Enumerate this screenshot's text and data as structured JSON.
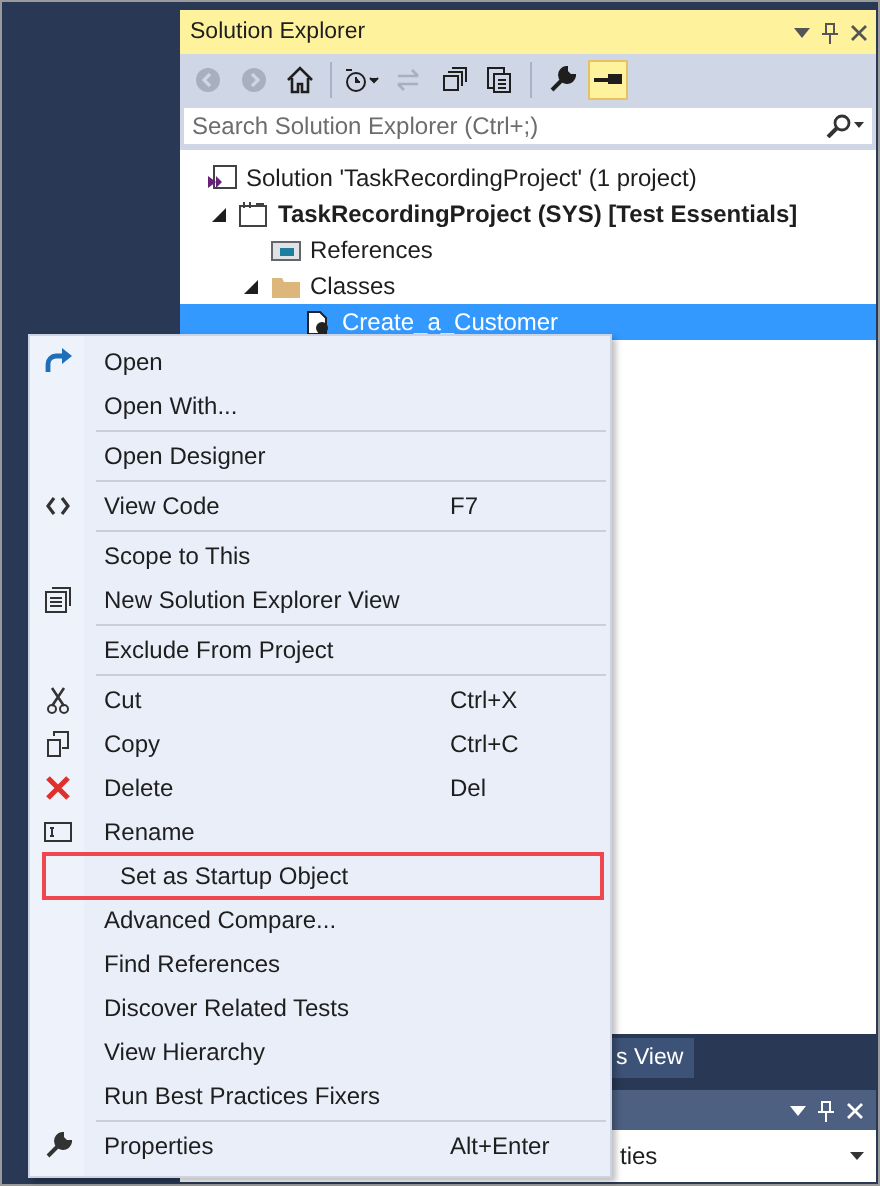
{
  "solution_explorer": {
    "title": "Solution Explorer",
    "toolbar": [
      {
        "kind": "back",
        "disabled": true
      },
      {
        "kind": "forward",
        "disabled": true
      },
      {
        "kind": "home",
        "disabled": false
      },
      {
        "kind": "history",
        "disabled": false
      },
      {
        "kind": "sync",
        "disabled": true
      },
      {
        "kind": "collapse",
        "disabled": false
      },
      {
        "kind": "copy",
        "disabled": false
      },
      {
        "kind": "properties",
        "disabled": false
      },
      {
        "kind": "preview",
        "disabled": false,
        "on": true
      }
    ],
    "search": {
      "placeholder": "Search Solution Explorer (Ctrl+;)"
    },
    "tree": [
      {
        "kind": "solution",
        "label": "Solution 'TaskRecordingProject' (1 project)",
        "selected": false,
        "children": [
          {
            "kind": "project",
            "label": "TaskRecordingProject (SYS) [Test Essentials]",
            "selected": false,
            "expanded": true,
            "children": [
              {
                "kind": "references",
                "label": "References",
                "selected": false
              },
              {
                "kind": "folder",
                "label": "Classes",
                "selected": false,
                "expanded": true,
                "children": [
                  {
                    "kind": "class",
                    "label": "Create_a_Customer",
                    "selected": true
                  }
                ]
              }
            ]
          }
        ]
      }
    ]
  },
  "tab_strip": {
    "tabs": [
      {
        "label": "s View",
        "selected": true
      }
    ]
  },
  "properties_panel": {
    "value": "ties"
  },
  "context_menu": {
    "items": [
      {
        "kind": "item",
        "label": "Open"
      },
      {
        "kind": "item",
        "label": "Open With..."
      },
      {
        "kind": "separator"
      },
      {
        "kind": "item",
        "label": "Open Designer"
      },
      {
        "kind": "separator"
      },
      {
        "kind": "item",
        "label": "View Code",
        "shortcut": "F7"
      },
      {
        "kind": "separator"
      },
      {
        "kind": "item",
        "label": "Scope to This"
      },
      {
        "kind": "item",
        "label": "New Solution Explorer View"
      },
      {
        "kind": "separator"
      },
      {
        "kind": "item",
        "label": "Exclude From Project"
      },
      {
        "kind": "separator"
      },
      {
        "kind": "item",
        "label": "Cut",
        "shortcut": "Ctrl+X"
      },
      {
        "kind": "item",
        "label": "Copy",
        "shortcut": "Ctrl+C"
      },
      {
        "kind": "item",
        "label": "Delete",
        "shortcut": "Del"
      },
      {
        "kind": "item",
        "label": "Rename"
      },
      {
        "kind": "item",
        "label": "Set as Startup Object",
        "highlighted": true
      },
      {
        "kind": "item",
        "label": "Advanced Compare..."
      },
      {
        "kind": "item",
        "label": "Find References"
      },
      {
        "kind": "item",
        "label": "Discover Related Tests"
      },
      {
        "kind": "item",
        "label": "View Hierarchy"
      },
      {
        "kind": "item",
        "label": "Run Best Practices Fixers"
      },
      {
        "kind": "separator"
      },
      {
        "kind": "item",
        "label": "Properties",
        "shortcut": "Alt+Enter"
      }
    ]
  }
}
